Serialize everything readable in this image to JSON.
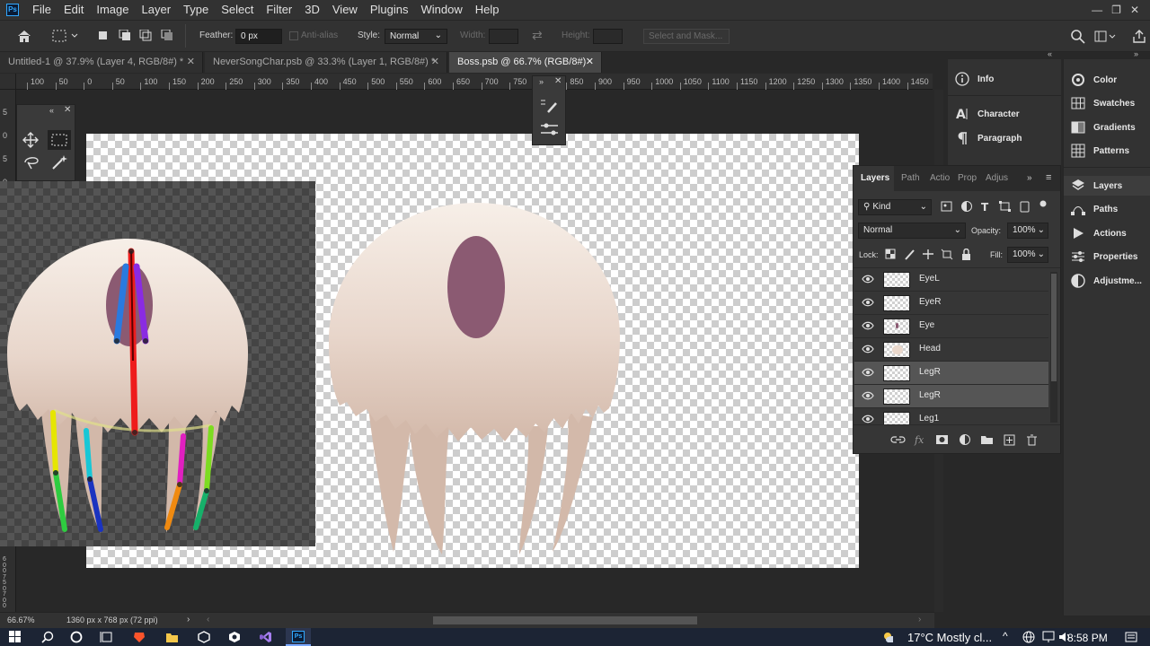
{
  "app": {
    "logo": "Ps"
  },
  "menu": [
    "File",
    "Edit",
    "Image",
    "Layer",
    "Type",
    "Select",
    "Filter",
    "3D",
    "View",
    "Plugins",
    "Window",
    "Help"
  ],
  "window_controls": {
    "minimize": "—",
    "restore": "❐",
    "close": "✕"
  },
  "options": {
    "feather_label": "Feather:",
    "feather_value": "0 px",
    "antialias_label": "Anti-alias",
    "style_label": "Style:",
    "style_value": "Normal",
    "width_label": "Width:",
    "height_label": "Height:",
    "select_mask": "Select and Mask..."
  },
  "tabs": [
    {
      "label": "Untitled-1 @ 37.9% (Layer 4, RGB/8#) *"
    },
    {
      "label": "NeverSongChar.psb @ 33.3% (Layer 1, RGB/8#) *"
    },
    {
      "label": "Boss.psb @ 66.7% (RGB/8#)"
    }
  ],
  "ruler_top": [
    "100",
    "50",
    "0",
    "50",
    "100",
    "150",
    "200",
    "250",
    "300",
    "350",
    "400",
    "450",
    "500",
    "550",
    "600",
    "650",
    "700",
    "750",
    "800",
    "850",
    "900",
    "950",
    "1000",
    "1050",
    "1100",
    "1150",
    "1200",
    "1250",
    "1300",
    "1350",
    "1400",
    "1450"
  ],
  "ruler_left": [
    "5",
    "0",
    "5",
    "0",
    "5"
  ],
  "ruler_left_bottom": [
    "6",
    "0",
    "0",
    "7",
    "5",
    "0",
    "7",
    "0",
    "0"
  ],
  "right_panels_a": [
    {
      "label": "Info",
      "icon": "info-icon"
    },
    {
      "label": "Character",
      "icon": "character-icon"
    },
    {
      "label": "Paragraph",
      "icon": "paragraph-icon"
    }
  ],
  "right_panels_b": [
    {
      "label": "Color",
      "icon": "color-icon"
    },
    {
      "label": "Swatches",
      "icon": "swatches-icon"
    },
    {
      "label": "Gradients",
      "icon": "gradients-icon"
    },
    {
      "label": "Patterns",
      "icon": "patterns-icon"
    },
    {
      "label": "Layers",
      "icon": "layers-icon"
    },
    {
      "label": "Paths",
      "icon": "paths-icon"
    },
    {
      "label": "Actions",
      "icon": "actions-icon"
    },
    {
      "label": "Properties",
      "icon": "properties-icon"
    },
    {
      "label": "Adjustme...",
      "icon": "adjustments-icon"
    }
  ],
  "layers_panel": {
    "tabs": [
      "Layers",
      "Path",
      "Actio",
      "Prop",
      "Adjus"
    ],
    "kind_label": "Kind",
    "blend_mode": "Normal",
    "opacity_label": "Opacity:",
    "opacity_value": "100%",
    "lock_label": "Lock:",
    "fill_label": "Fill:",
    "fill_value": "100%",
    "layers": [
      {
        "name": "EyeL",
        "selected": false
      },
      {
        "name": "EyeR",
        "selected": false
      },
      {
        "name": "Eye",
        "selected": false
      },
      {
        "name": "Head",
        "selected": false
      },
      {
        "name": "LegR",
        "selected": true
      },
      {
        "name": "LegR",
        "selected": true
      },
      {
        "name": "Leg1",
        "selected": false
      }
    ]
  },
  "status": {
    "zoom": "66.67%",
    "doc_info": "1360 px x 768 px (72 ppi)"
  },
  "taskbar": {
    "weather": "17°C  Mostly cl...",
    "time": "8:58 PM"
  },
  "colors": {
    "accent": "#31a8ff",
    "canvas_bg": "#282828",
    "panel": "#323232",
    "creature_top": "#f6ece4",
    "creature_bottom": "#d2b7a8",
    "eye": "#8b5a72"
  }
}
